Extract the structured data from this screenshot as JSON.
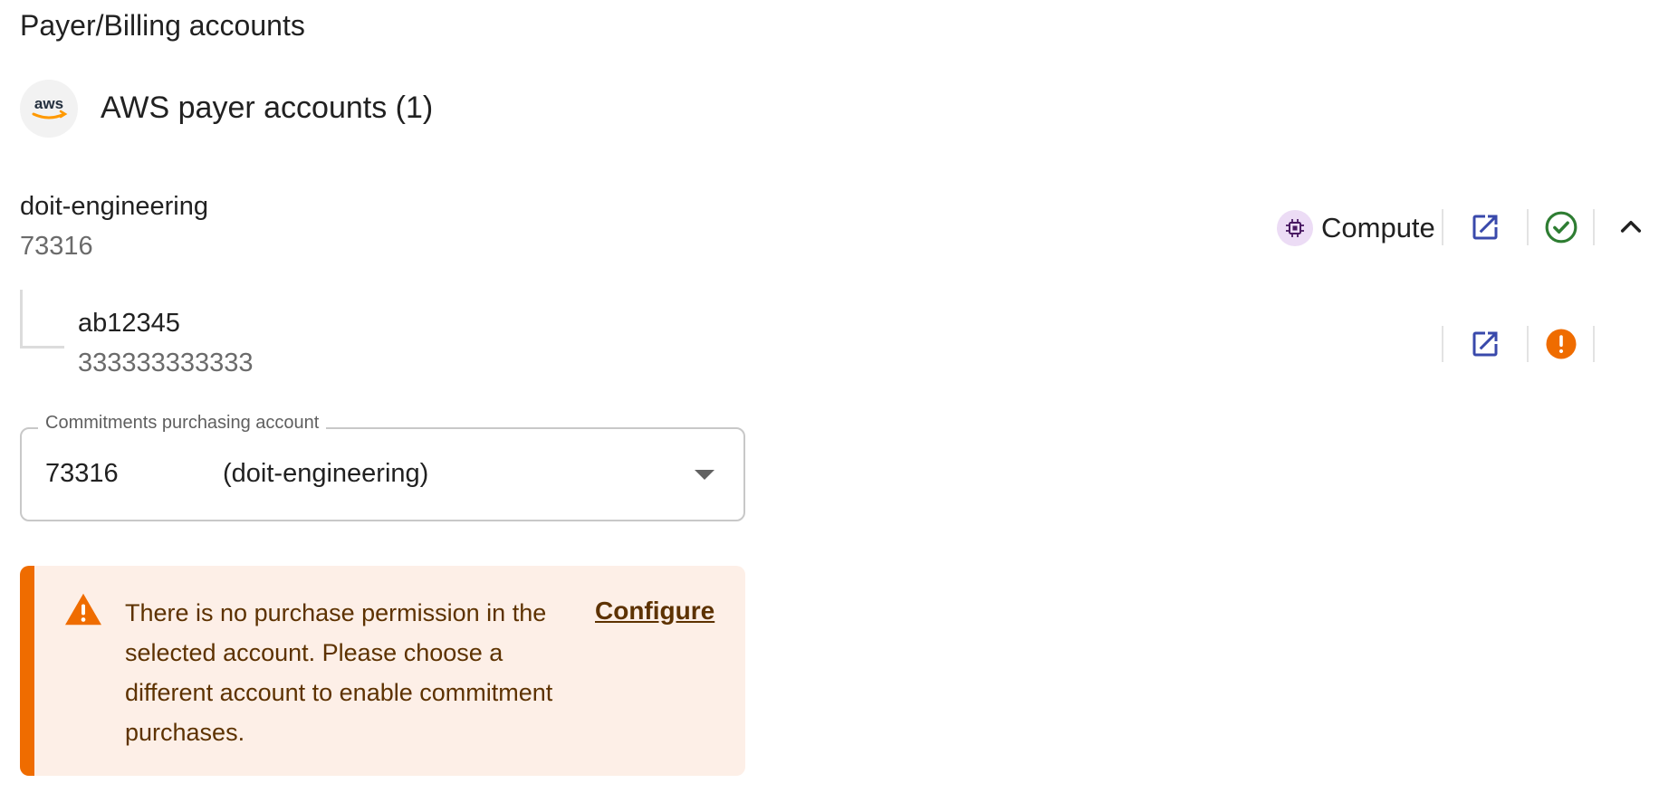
{
  "section": {
    "title": "Payer/Billing accounts"
  },
  "provider": {
    "title": "AWS payer accounts (1)",
    "logo_text": "aws"
  },
  "payer_account": {
    "name": "doit-engineering",
    "id": "73316",
    "chip_label": "Compute",
    "status": "ok"
  },
  "linked_account": {
    "name": "ab12345",
    "id": "333333333333",
    "status": "warning"
  },
  "purchasing_field": {
    "label": "Commitments purchasing account",
    "value_id": "73316",
    "value_name": "(doit-engineering)"
  },
  "alert": {
    "message": "There is no purchase permission in the selected account. Please choose a different account to enable commitment purchases.",
    "action_label": "Configure"
  },
  "colors": {
    "link_icon": "#3949ab",
    "success": "#2e7d32",
    "warning": "#ef6c00",
    "alert_bg": "#fdefe7",
    "alert_text": "#5d3200"
  }
}
